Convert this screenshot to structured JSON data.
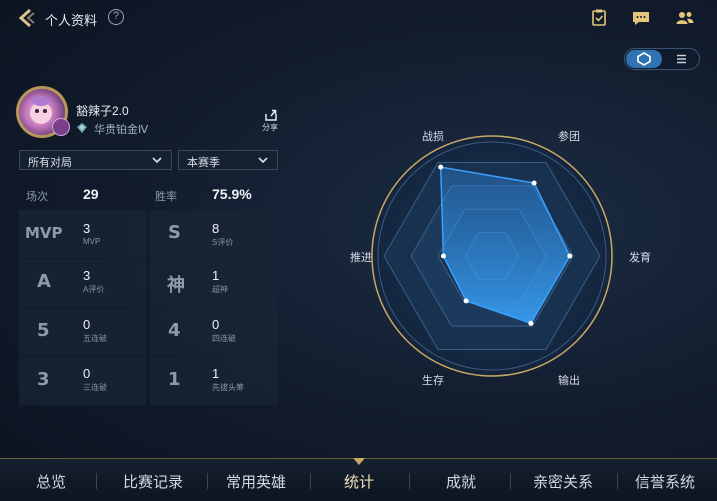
{
  "header": {
    "title": "个人资料",
    "help_glyph": "?",
    "icons": [
      "task-icon",
      "chat-icon",
      "friends-icon"
    ]
  },
  "view_toggle": {
    "selected": "radar"
  },
  "profile": {
    "name": "豁辣子2.0",
    "rank": "华贵铂金Ⅳ",
    "share_label": "分享"
  },
  "filters": {
    "mode": "所有对局",
    "season": "本赛季"
  },
  "summary": {
    "matches_label": "场次",
    "matches_value": "29",
    "winrate_label": "胜率",
    "winrate_value": "75.9%"
  },
  "stats": [
    {
      "icon": "MVP",
      "value": "3",
      "label": "MVP"
    },
    {
      "icon": "S",
      "value": "8",
      "label": "S评价"
    },
    {
      "icon": "A",
      "value": "3",
      "label": "A评价"
    },
    {
      "icon": "神",
      "value": "1",
      "label": "超神"
    },
    {
      "icon": "5",
      "value": "0",
      "label": "五连破"
    },
    {
      "icon": "4",
      "value": "0",
      "label": "四连破"
    },
    {
      "icon": "3",
      "value": "0",
      "label": "三连破"
    },
    {
      "icon": "1",
      "value": "1",
      "label": "先拔头筹"
    }
  ],
  "radar": {
    "labels": [
      "战损",
      "参团",
      "发育",
      "输出",
      "生存",
      "推进"
    ],
    "values": [
      0.95,
      0.78,
      0.72,
      0.72,
      0.48,
      0.45
    ],
    "accent": "#3aa0ff"
  },
  "nav": {
    "tabs": [
      "总览",
      "比赛记录",
      "常用英雄",
      "统计",
      "成就",
      "亲密关系",
      "信誉系统"
    ],
    "active": "统计"
  }
}
